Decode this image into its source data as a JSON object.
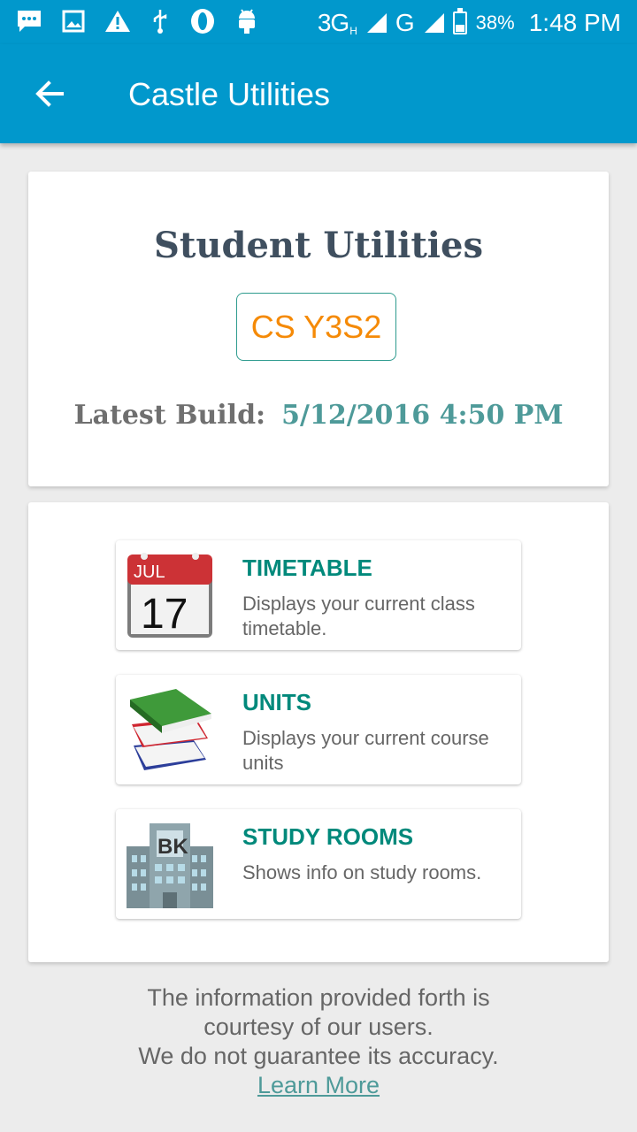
{
  "status_bar": {
    "network_3g": "3G",
    "network_3g_sup": "H",
    "network_g": "G",
    "battery": "38%",
    "time": "1:48 PM"
  },
  "app_bar": {
    "title": "Castle Utilities"
  },
  "header": {
    "title": "Student Utilities",
    "badge": "CS Y3S2",
    "build_label": "Latest Build:",
    "build_value": "5/12/2016 4:50 PM"
  },
  "menu": [
    {
      "title": "TIMETABLE",
      "desc": "Displays your current class timetable.",
      "icon": "calendar-icon",
      "cal_month": "JUL",
      "cal_day": "17"
    },
    {
      "title": "UNITS",
      "desc": "Displays your current course units",
      "icon": "books-icon"
    },
    {
      "title": "STUDY ROOMS",
      "desc": "Shows info on study rooms.",
      "icon": "building-icon",
      "building_label": "BK"
    }
  ],
  "footer": {
    "line1": "The information provided forth is",
    "line2": "courtesy of our users.",
    "line3": "We do not guarantee its accuracy.",
    "link": "Learn More"
  },
  "colors": {
    "primary": "#0198cc",
    "accent_teal": "#00897b",
    "badge_orange": "#f58a07",
    "build_value": "#4e9a99"
  }
}
